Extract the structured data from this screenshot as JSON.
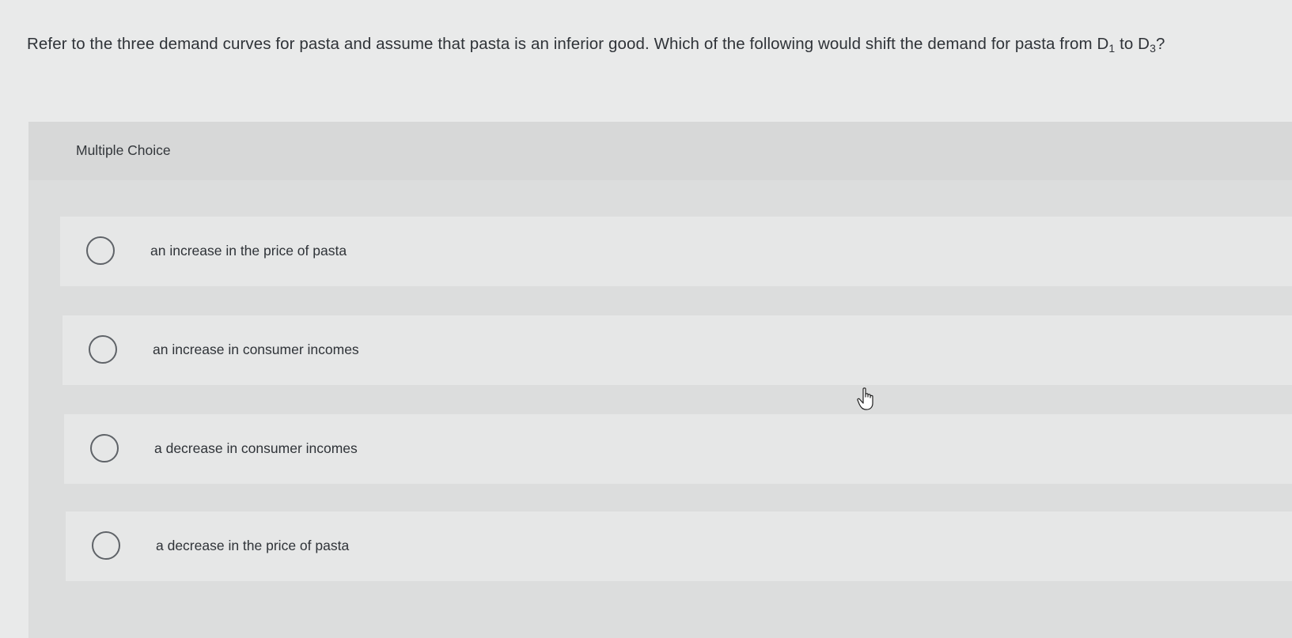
{
  "question": {
    "text_main": "Refer to the three demand curves for pasta and assume that pasta is an inferior good. Which of the following would shift the demand for pasta from D",
    "sub_1": "1",
    "text_mid": " to D",
    "sub_2": "3",
    "text_end": "?"
  },
  "multiple_choice": {
    "label": "Multiple Choice",
    "options": [
      {
        "label": "an increase in the price of pasta"
      },
      {
        "label": "an increase in consumer incomes"
      },
      {
        "label": "a decrease in consumer incomes"
      },
      {
        "label": "a decrease in the price of pasta"
      }
    ]
  },
  "icons": {
    "radio": "radio-unselected-icon",
    "cursor": "hand-pointer-icon"
  },
  "colors": {
    "background": "#e9eaea",
    "panel": "#dcdddd",
    "option_row": "#e6e7e7",
    "text": "#2f3338",
    "radio_border": "#5f6368"
  }
}
